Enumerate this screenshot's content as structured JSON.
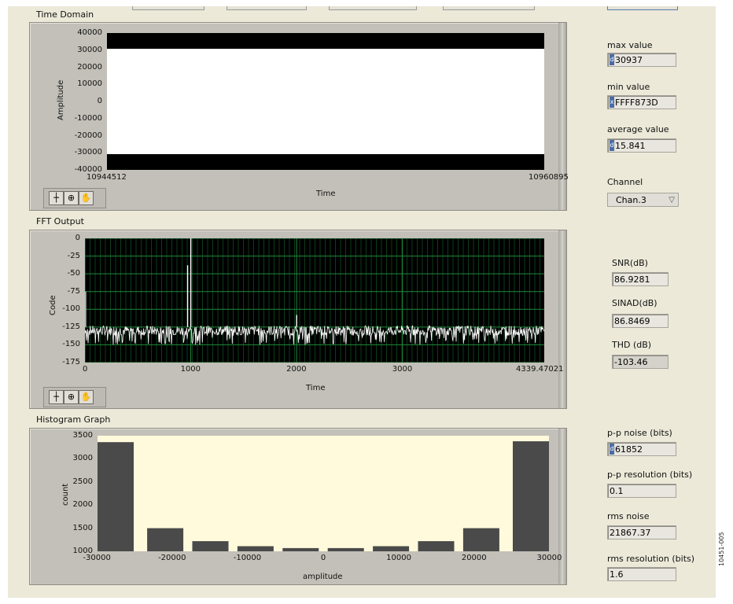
{
  "time_domain": {
    "title": "Time Domain",
    "chart_data": {
      "type": "line",
      "title": "",
      "xlabel": "Time",
      "ylabel": "Amplitude",
      "x_ticks": [
        "10944512",
        "10960895"
      ],
      "xlim": [
        10944512,
        10960895
      ],
      "y_ticks": [
        "40000",
        "30000",
        "20000",
        "10000",
        "0",
        "-10000",
        "-20000",
        "-30000",
        "-40000"
      ],
      "ylim": [
        -40000,
        40000
      ],
      "signal_band": [
        -30937,
        30937
      ],
      "colors": {
        "background": "#000000",
        "trace": "#ffffff"
      }
    }
  },
  "fft_output": {
    "title": "FFT Output",
    "chart_data": {
      "type": "line",
      "title": "",
      "xlabel": "Time",
      "ylabel": "Code",
      "x_ticks": [
        "0",
        "1000",
        "2000",
        "3000",
        "4339.47021"
      ],
      "xlim": [
        0,
        4339.47
      ],
      "y_ticks": [
        "0",
        "-25",
        "-50",
        "-75",
        "-100",
        "-125",
        "-150",
        "-175"
      ],
      "ylim": [
        -175,
        0
      ],
      "noise_floor_range": [
        -150,
        -118
      ],
      "spikes": [
        {
          "x": 1000,
          "y": 0
        },
        {
          "x": 970,
          "y": -38
        },
        {
          "x": 2000,
          "y": -108
        }
      ],
      "grid": true,
      "colors": {
        "background": "#000000",
        "grid": "#1f8a3a",
        "trace": "#ffffff"
      }
    }
  },
  "histogram": {
    "title": "Histogram Graph",
    "chart_data": {
      "type": "bar",
      "title": "",
      "xlabel": "amplitude",
      "ylabel": "count",
      "x_ticks": [
        "-30000",
        "-20000",
        "-10000",
        "0",
        "10000",
        "20000",
        "30000"
      ],
      "xlim": [
        -30000,
        30000
      ],
      "y_ticks": [
        "3500",
        "3000",
        "2500",
        "2000",
        "1500",
        "1000"
      ],
      "ylim": [
        1000,
        3500
      ],
      "bins": [
        {
          "center": -27500,
          "value": 3360
        },
        {
          "center": -21000,
          "value": 1500
        },
        {
          "center": -15000,
          "value": 1220
        },
        {
          "center": -9000,
          "value": 1110
        },
        {
          "center": -3000,
          "value": 1070
        },
        {
          "center": 3000,
          "value": 1070
        },
        {
          "center": 9000,
          "value": 1110
        },
        {
          "center": 15000,
          "value": 1220
        },
        {
          "center": 21000,
          "value": 1500
        },
        {
          "center": 27500,
          "value": 3380
        }
      ],
      "colors": {
        "background": "#fffadc",
        "bar": "#4a4a4a"
      }
    }
  },
  "indicators": {
    "max_value": {
      "label": "max value",
      "radix": "d",
      "value": "30937"
    },
    "min_value": {
      "label": "min value",
      "radix": "x",
      "value": "FFFF873D"
    },
    "average_value": {
      "label": "average value",
      "radix": "d",
      "value": "15.841"
    },
    "channel": {
      "label": "Channel",
      "value": "Chan.3"
    },
    "snr": {
      "label": "SNR(dB)",
      "value": "86.9281"
    },
    "sinad": {
      "label": "SINAD(dB)",
      "value": "86.8469"
    },
    "thd": {
      "label": "THD (dB)",
      "value": "-103.46"
    },
    "pp_noise": {
      "label": "p-p noise (bits)",
      "radix": "d",
      "value": "61852"
    },
    "pp_resolution": {
      "label": "p-p resolution (bits)",
      "value": "0.1"
    },
    "rms_noise": {
      "label": "rms noise",
      "value": "21867.37"
    },
    "rms_resolution": {
      "label": "rms resolution (bits)",
      "value": "1.6"
    }
  },
  "figure_code": "10451-005",
  "toolbar_icons": [
    "cursor-move-icon",
    "zoom-icon",
    "pan-hand-icon"
  ]
}
